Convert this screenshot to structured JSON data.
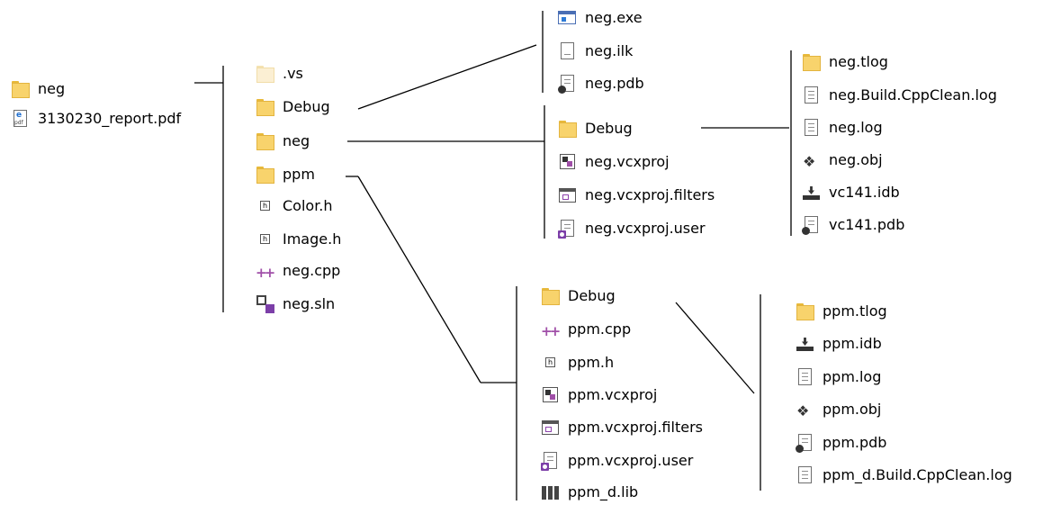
{
  "root": {
    "folder": "neg",
    "report": "3130230_report.pdf"
  },
  "neg_folder": {
    "vs": ".vs",
    "debug": "Debug",
    "neg": "neg",
    "ppm": "ppm",
    "color_h": "Color.h",
    "image_h": "Image.h",
    "neg_cpp": "neg.cpp",
    "neg_sln": "neg.sln"
  },
  "debug_folder": {
    "exe": "neg.exe",
    "ilk": "neg.ilk",
    "pdb": "neg.pdb"
  },
  "neg_project": {
    "debug": "Debug",
    "vcxproj": "neg.vcxproj",
    "filters": "neg.vcxproj.filters",
    "user": "neg.vcxproj.user"
  },
  "neg_debug": {
    "tlog": "neg.tlog",
    "cppclean": "neg.Build.CppClean.log",
    "log": "neg.log",
    "obj": "neg.obj",
    "idb": "vc141.idb",
    "pdb": "vc141.pdb"
  },
  "ppm_project": {
    "debug": "Debug",
    "cpp": "ppm.cpp",
    "h": "ppm.h",
    "vcxproj": "ppm.vcxproj",
    "filters": "ppm.vcxproj.filters",
    "user": "ppm.vcxproj.user",
    "lib": "ppm_d.lib"
  },
  "ppm_debug": {
    "tlog": "ppm.tlog",
    "idb": "ppm.idb",
    "log": "ppm.log",
    "obj": "ppm.obj",
    "pdb": "ppm.pdb",
    "cppclean": "ppm_d.Build.CppClean.log"
  },
  "colors": {
    "folder": "#F8D36C",
    "line": "#000000",
    "vs_purple": "#7C3FA8"
  }
}
